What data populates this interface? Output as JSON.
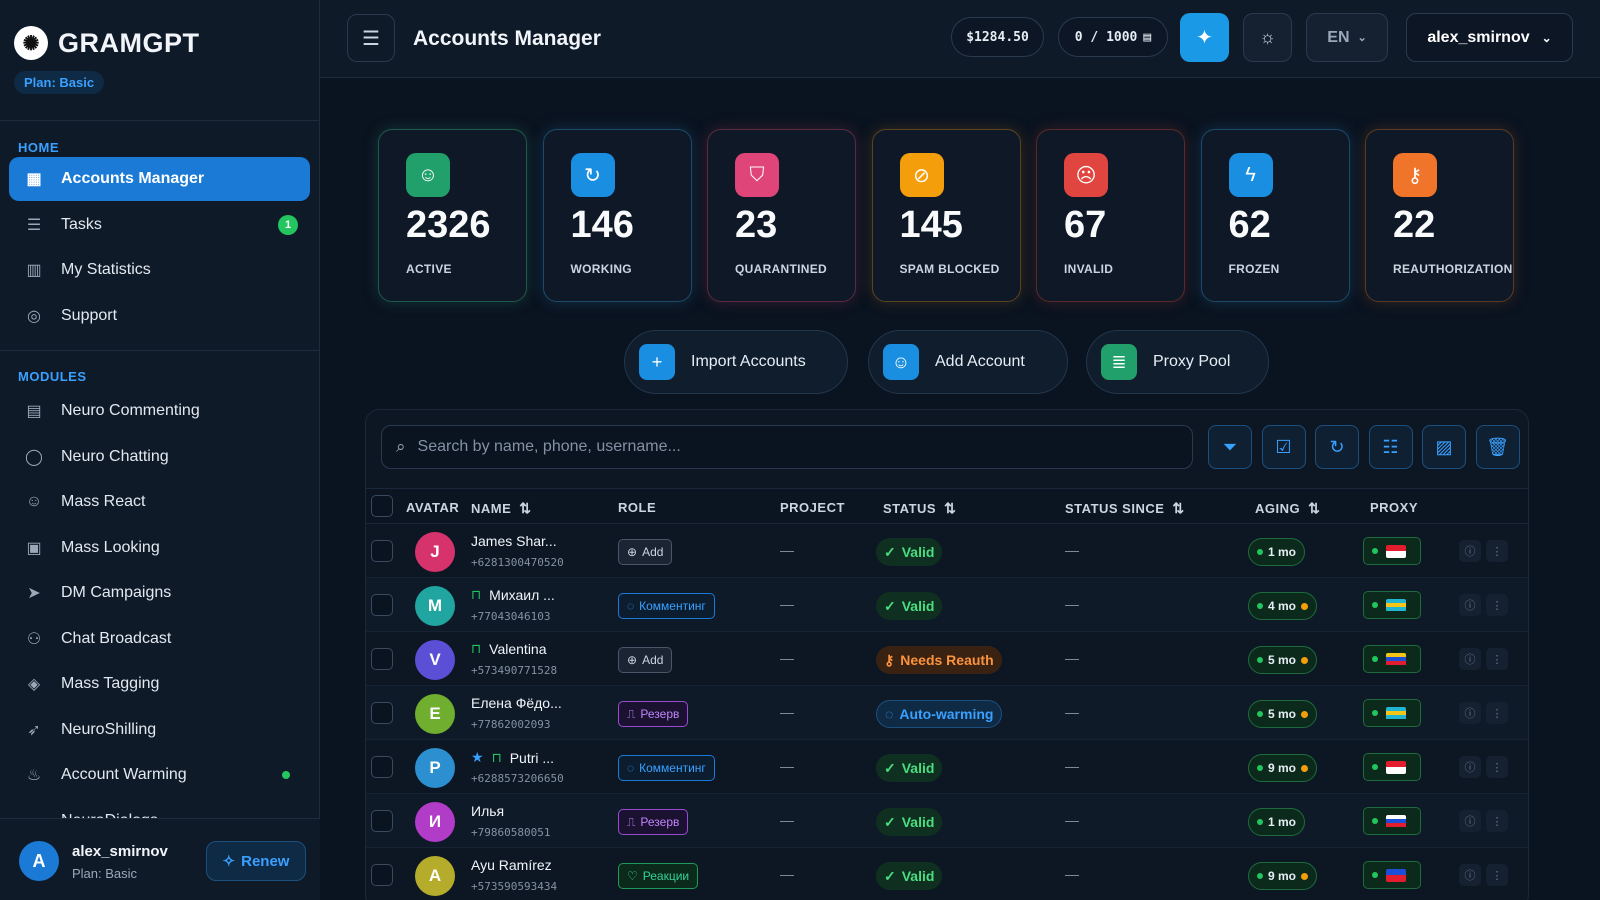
{
  "app": {
    "logo_text": "GRAMGPT",
    "plan_pill": "Plan: Basic"
  },
  "sidebar": {
    "home_label": "HOME",
    "home_items": [
      {
        "label": "Accounts Manager",
        "icon": "grid-icon",
        "active": true
      },
      {
        "label": "Tasks",
        "icon": "list-icon",
        "badge": "1"
      },
      {
        "label": "My Statistics",
        "icon": "bar-chart-icon"
      },
      {
        "label": "Support",
        "icon": "lifebuoy-icon"
      }
    ],
    "modules_label": "MODULES",
    "module_items": [
      {
        "label": "Neuro Commenting",
        "icon": "comments-icon"
      },
      {
        "label": "Neuro Chatting",
        "icon": "chat-bubble-icon"
      },
      {
        "label": "Mass React",
        "icon": "smiley-icon"
      },
      {
        "label": "Mass Looking",
        "icon": "monitor-eye-icon"
      },
      {
        "label": "DM Campaigns",
        "icon": "message-arrow-icon"
      },
      {
        "label": "Chat Broadcast",
        "icon": "users-icon"
      },
      {
        "label": "Mass Tagging",
        "icon": "tag-icon"
      },
      {
        "label": "NeuroShilling",
        "icon": "rocket-icon"
      },
      {
        "label": "Account Warming",
        "icon": "flame-icon",
        "dot": true
      },
      {
        "label": "NeuroDialogs",
        "icon": "dialog-icon"
      }
    ],
    "footer": {
      "avatar": "A",
      "name": "alex_smirnov",
      "plan": "Plan: Basic",
      "renew": "Renew"
    }
  },
  "topbar": {
    "title": "Accounts Manager",
    "balance": "$1284.50",
    "quota": "0 / 1000",
    "language": "EN",
    "username": "alex_smirnov"
  },
  "stats": [
    {
      "value": "2326",
      "label": "ACTIVE",
      "color": "#22a06b",
      "border": "#1e5a4a",
      "icon": "user-icon"
    },
    {
      "value": "146",
      "label": "WORKING",
      "color": "#1a8ee0",
      "border": "#1c4a6a",
      "icon": "refresh-icon"
    },
    {
      "value": "23",
      "label": "QUARANTINED",
      "color": "#e0457a",
      "border": "#5a2a3e",
      "icon": "shield-icon"
    },
    {
      "value": "145",
      "label": "SPAM BLOCKED",
      "color": "#f59e0b",
      "border": "#5a4420",
      "icon": "block-icon"
    },
    {
      "value": "67",
      "label": "INVALID",
      "color": "#e0453f",
      "border": "#5a2a2a",
      "icon": "user-x-icon"
    },
    {
      "value": "62",
      "label": "FROZEN",
      "color": "#1a8ee0",
      "border": "#1c4a6a",
      "icon": "bolt-icon"
    },
    {
      "value": "22",
      "label": "REAUTHORIZATION",
      "color": "#f0742a",
      "border": "#5a3a22",
      "icon": "key-icon"
    }
  ],
  "actions": [
    {
      "label": "Import Accounts",
      "color": "#1a8ee0",
      "icon": "plus-icon"
    },
    {
      "label": "Add Account",
      "color": "#1a8ee0",
      "icon": "user-add-icon"
    },
    {
      "label": "Proxy Pool",
      "color": "#22a06b",
      "icon": "server-icon"
    }
  ],
  "search": {
    "placeholder": "Search by name, phone, username..."
  },
  "toolbar": [
    "filter-icon",
    "check-square-icon",
    "refresh-icon",
    "sliders-icon",
    "image-icon",
    "trash-icon"
  ],
  "table": {
    "headers": {
      "avatar": "AVATAR",
      "name": "NAME",
      "role": "ROLE",
      "project": "PROJECT",
      "status": "STATUS",
      "status_since": "STATUS SINCE",
      "aging": "AGING",
      "proxy": "PROXY"
    },
    "rows": [
      {
        "initial": "J",
        "avatar_color": "#d6336c",
        "name": "James Shar...",
        "phone": "+6281300470520",
        "lock": false,
        "star": false,
        "role": "Add",
        "role_kind": "add",
        "project": "—",
        "status": "Valid",
        "status_kind": "valid",
        "since": "—",
        "aging": "1 mo",
        "aging_warn": false,
        "flag": [
          "#e11d2e",
          "#ffffff"
        ]
      },
      {
        "initial": "M",
        "avatar_color": "#20a5a0",
        "name": "Михаил ...",
        "phone": "+77043046103",
        "lock": true,
        "star": false,
        "role": "Комментинг",
        "role_kind": "blue",
        "project": "—",
        "status": "Valid",
        "status_kind": "valid",
        "since": "—",
        "aging": "4 mo",
        "aging_warn": true,
        "flag": [
          "#22b5d0",
          "#f5c518",
          "#22b5d0"
        ]
      },
      {
        "initial": "V",
        "avatar_color": "#5b4fd6",
        "name": "Valentina",
        "phone": "+573490771528",
        "lock": true,
        "star": false,
        "role": "Add",
        "role_kind": "add",
        "project": "—",
        "status": "Needs Reauth",
        "status_kind": "reauth",
        "since": "—",
        "aging": "5 mo",
        "aging_warn": true,
        "flag": [
          "#f5c518",
          "#1d4ed8",
          "#e11d2e"
        ]
      },
      {
        "initial": "E",
        "avatar_color": "#6fae2e",
        "name": "Елена Фёдо...",
        "phone": "+77862002093",
        "lock": false,
        "star": false,
        "role": "Резерв",
        "role_kind": "purple",
        "project": "—",
        "status": "Auto-warming",
        "status_kind": "warming",
        "since": "—",
        "aging": "5 mo",
        "aging_warn": true,
        "flag": [
          "#22b5d0",
          "#f5c518",
          "#22b5d0"
        ]
      },
      {
        "initial": "P",
        "avatar_color": "#2b8fd0",
        "name": "Putri ...",
        "phone": "+6288573206650",
        "lock": true,
        "star": true,
        "role": "Комментинг",
        "role_kind": "blue",
        "project": "—",
        "status": "Valid",
        "status_kind": "valid",
        "since": "—",
        "aging": "9 mo",
        "aging_warn": true,
        "flag": [
          "#e11d2e",
          "#ffffff"
        ]
      },
      {
        "initial": "И",
        "avatar_color": "#b03cc8",
        "name": "Илья",
        "phone": "+79860580051",
        "lock": false,
        "star": false,
        "role": "Резерв",
        "role_kind": "purple",
        "project": "—",
        "status": "Valid",
        "status_kind": "valid",
        "since": "—",
        "aging": "1 mo",
        "aging_warn": false,
        "flag": [
          "#ffffff",
          "#1d4ed8",
          "#e11d2e"
        ]
      },
      {
        "initial": "A",
        "avatar_color": "#b4ac2a",
        "name": "Ayu Ramírez",
        "phone": "+573590593434",
        "lock": false,
        "star": false,
        "role": "Реакции",
        "role_kind": "green",
        "project": "—",
        "status": "Valid",
        "status_kind": "valid",
        "since": "—",
        "aging": "9 mo",
        "aging_warn": true,
        "flag": [
          "#1d4ed8",
          "#e11d2e"
        ]
      }
    ]
  }
}
